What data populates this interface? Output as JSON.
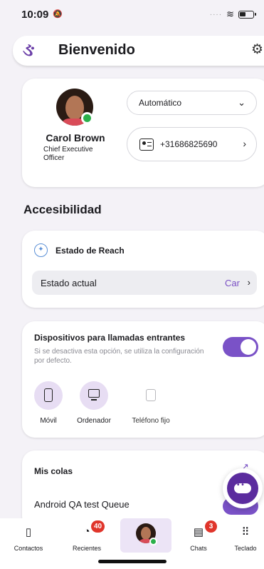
{
  "status_bar": {
    "time": "10:09",
    "mute_icon": "bell-slash-icon"
  },
  "header": {
    "title": "Bienvenido",
    "logo_icon": "logo-icon",
    "settings_icon": "gear-icon"
  },
  "profile": {
    "name": "Carol Brown",
    "role": "Chief Executive Officer",
    "presence": "available",
    "status_select": {
      "value": "Automático"
    },
    "phone": {
      "value": "+31686825690"
    }
  },
  "accessibility": {
    "section_title": "Accesibilidad"
  },
  "reach": {
    "title": "Estado de Reach",
    "row_label": "Estado actual",
    "row_value": "Car"
  },
  "devices": {
    "title": "Dispositivos para llamadas entrantes",
    "description": "Si se desactiva esta opción, se utiliza la configuración por defecto.",
    "toggle_on": true,
    "items": [
      {
        "label": "Móvil",
        "icon": "mobile-phone-icon",
        "active": true
      },
      {
        "label": "Ordenador",
        "icon": "desktop-icon",
        "active": true
      },
      {
        "label": "Teléfono fijo",
        "icon": "landline-phone-icon",
        "active": false
      }
    ]
  },
  "queues": {
    "title": "Mis colas",
    "queue_name": "Android QA test Queue",
    "toggle_on": true
  },
  "tab_bar": {
    "tabs": [
      {
        "label": "Contactos",
        "icon": "contacts-icon"
      },
      {
        "label": "Recientes",
        "icon": "recent-calls-icon",
        "badge": "40"
      },
      {
        "label": "",
        "icon": "avatar"
      },
      {
        "label": "Chats",
        "icon": "chat-icon",
        "badge": "3"
      },
      {
        "label": "Teclado",
        "icon": "keypad-icon"
      }
    ]
  },
  "colors": {
    "accent": "#7a52c7",
    "brand": "#5b2c9e",
    "badge": "#e0352b",
    "presence": "#2bb04b"
  }
}
